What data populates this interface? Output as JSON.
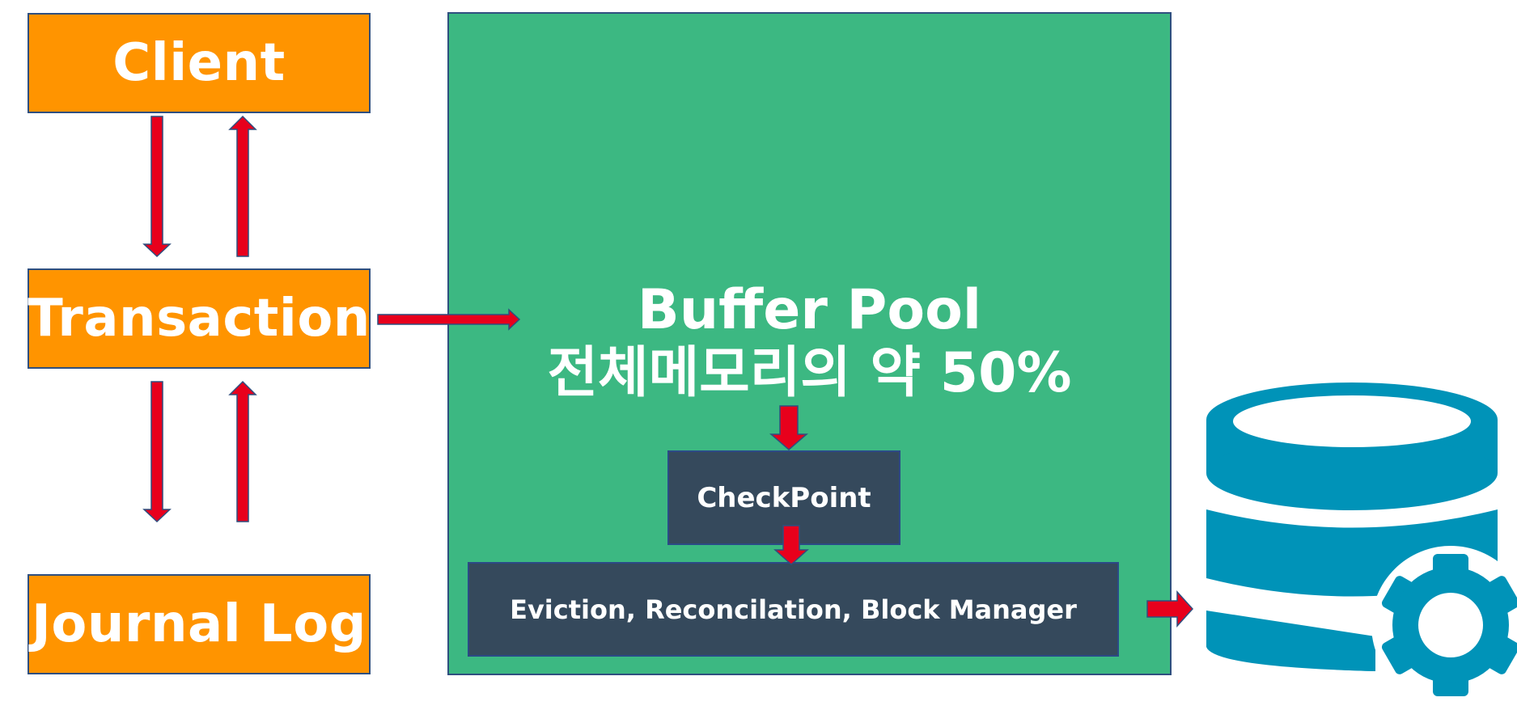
{
  "diagram": {
    "client": {
      "label": "Client"
    },
    "transaction": {
      "label": "Transaction"
    },
    "journal_log": {
      "label": "Journal Log"
    },
    "buffer_pool": {
      "title": "Buffer Pool",
      "subtitle": "전체메모리의 약 50%"
    },
    "checkpoint": {
      "label": "CheckPoint"
    },
    "eviction": {
      "label": "Eviction, Reconcilation, Block Manager"
    },
    "storage": {
      "icon": "database-gear-icon"
    }
  },
  "colors": {
    "orange_box": "#ff9400",
    "buffer_pool": "#3cb882",
    "dark_box": "#35495c",
    "arrow": "#e8001c",
    "database": "#0093b8"
  }
}
